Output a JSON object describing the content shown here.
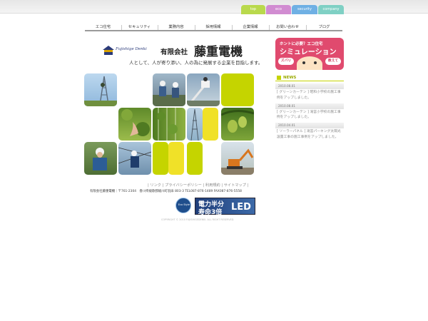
{
  "top_tabs": [
    {
      "label": "top",
      "color": "#b9d94c"
    },
    {
      "label": "eco",
      "color": "#d18cd1"
    },
    {
      "label": "security",
      "color": "#6fb0e4"
    },
    {
      "label": "company",
      "color": "#7fd0c4"
    }
  ],
  "nav": [
    {
      "label": "エコ住宅"
    },
    {
      "label": "セキュリティ"
    },
    {
      "label": "業務内容"
    },
    {
      "label": "採用情報"
    },
    {
      "label": "企業情報"
    },
    {
      "label": "お問い合わせ"
    },
    {
      "label": "ブログ"
    }
  ],
  "header": {
    "logo_script": "Fujishige Denki",
    "company_type": "有限会社",
    "company_name": "藤重電機",
    "tagline": "人として、人が寄り添い、人の為に発展する企業を目指します。"
  },
  "colors": {
    "lime": "#c5d400",
    "yellow": "#f0e128",
    "leaf": "#6e9c2a"
  },
  "footer": {
    "links": [
      "リンク",
      "プライバシーポリシー",
      "利用規約",
      "サイトマップ"
    ],
    "address": "有限会社藤重電機｜〒761-2304　香川県綾歌郡綾川町羽床 803-3 TEL087-876-1489  FAX087-876-5558",
    "copyright": "COPYRIGHT © 2010 FUJISHIGEDENKI. ALL RIGHT RESERVED.",
    "eco_badge": "Eco Style",
    "led_banner": {
      "line1": "電力半分",
      "line2": "寿命3倍",
      "led": "LED"
    }
  },
  "sidebar": {
    "banner": {
      "title": "ホントに必要？エコ住宅",
      "main": "シミュレーション",
      "left_bubble": "ズバリ",
      "right_bubble": "教えて"
    },
    "news_heading": "NEWS",
    "news": [
      {
        "date": "2010.08.01",
        "text": "[ グリーンカーテン ] 昭和小学校の施工事例をアップしました。"
      },
      {
        "date": "2010.08.01",
        "text": "[ グリーンカーテン ] 滝宮小学校の施工事例をアップしました。"
      },
      {
        "date": "2010.04.01",
        "text": "[ ソーラーパネル ] 滝宮パーキング太陽光設置工事の施工事例をアップしました。"
      }
    ]
  }
}
